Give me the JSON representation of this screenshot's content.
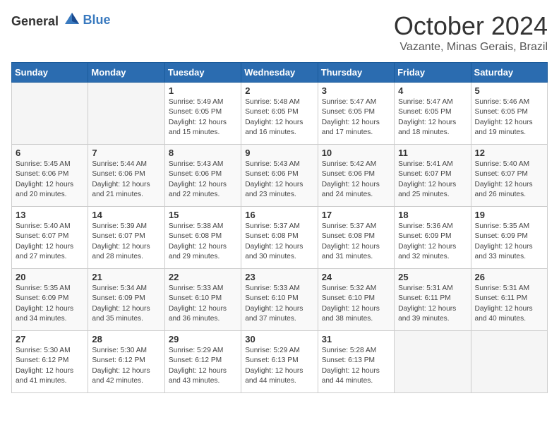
{
  "header": {
    "logo_general": "General",
    "logo_blue": "Blue",
    "month_year": "October 2024",
    "location": "Vazante, Minas Gerais, Brazil"
  },
  "days_of_week": [
    "Sunday",
    "Monday",
    "Tuesday",
    "Wednesday",
    "Thursday",
    "Friday",
    "Saturday"
  ],
  "weeks": [
    [
      {
        "day": "",
        "empty": true
      },
      {
        "day": "",
        "empty": true
      },
      {
        "day": "1",
        "sunrise": "5:49 AM",
        "sunset": "6:05 PM",
        "daylight": "12 hours and 15 minutes."
      },
      {
        "day": "2",
        "sunrise": "5:48 AM",
        "sunset": "6:05 PM",
        "daylight": "12 hours and 16 minutes."
      },
      {
        "day": "3",
        "sunrise": "5:47 AM",
        "sunset": "6:05 PM",
        "daylight": "12 hours and 17 minutes."
      },
      {
        "day": "4",
        "sunrise": "5:47 AM",
        "sunset": "6:05 PM",
        "daylight": "12 hours and 18 minutes."
      },
      {
        "day": "5",
        "sunrise": "5:46 AM",
        "sunset": "6:05 PM",
        "daylight": "12 hours and 19 minutes."
      }
    ],
    [
      {
        "day": "6",
        "sunrise": "5:45 AM",
        "sunset": "6:06 PM",
        "daylight": "12 hours and 20 minutes."
      },
      {
        "day": "7",
        "sunrise": "5:44 AM",
        "sunset": "6:06 PM",
        "daylight": "12 hours and 21 minutes."
      },
      {
        "day": "8",
        "sunrise": "5:43 AM",
        "sunset": "6:06 PM",
        "daylight": "12 hours and 22 minutes."
      },
      {
        "day": "9",
        "sunrise": "5:43 AM",
        "sunset": "6:06 PM",
        "daylight": "12 hours and 23 minutes."
      },
      {
        "day": "10",
        "sunrise": "5:42 AM",
        "sunset": "6:06 PM",
        "daylight": "12 hours and 24 minutes."
      },
      {
        "day": "11",
        "sunrise": "5:41 AM",
        "sunset": "6:07 PM",
        "daylight": "12 hours and 25 minutes."
      },
      {
        "day": "12",
        "sunrise": "5:40 AM",
        "sunset": "6:07 PM",
        "daylight": "12 hours and 26 minutes."
      }
    ],
    [
      {
        "day": "13",
        "sunrise": "5:40 AM",
        "sunset": "6:07 PM",
        "daylight": "12 hours and 27 minutes."
      },
      {
        "day": "14",
        "sunrise": "5:39 AM",
        "sunset": "6:07 PM",
        "daylight": "12 hours and 28 minutes."
      },
      {
        "day": "15",
        "sunrise": "5:38 AM",
        "sunset": "6:08 PM",
        "daylight": "12 hours and 29 minutes."
      },
      {
        "day": "16",
        "sunrise": "5:37 AM",
        "sunset": "6:08 PM",
        "daylight": "12 hours and 30 minutes."
      },
      {
        "day": "17",
        "sunrise": "5:37 AM",
        "sunset": "6:08 PM",
        "daylight": "12 hours and 31 minutes."
      },
      {
        "day": "18",
        "sunrise": "5:36 AM",
        "sunset": "6:09 PM",
        "daylight": "12 hours and 32 minutes."
      },
      {
        "day": "19",
        "sunrise": "5:35 AM",
        "sunset": "6:09 PM",
        "daylight": "12 hours and 33 minutes."
      }
    ],
    [
      {
        "day": "20",
        "sunrise": "5:35 AM",
        "sunset": "6:09 PM",
        "daylight": "12 hours and 34 minutes."
      },
      {
        "day": "21",
        "sunrise": "5:34 AM",
        "sunset": "6:09 PM",
        "daylight": "12 hours and 35 minutes."
      },
      {
        "day": "22",
        "sunrise": "5:33 AM",
        "sunset": "6:10 PM",
        "daylight": "12 hours and 36 minutes."
      },
      {
        "day": "23",
        "sunrise": "5:33 AM",
        "sunset": "6:10 PM",
        "daylight": "12 hours and 37 minutes."
      },
      {
        "day": "24",
        "sunrise": "5:32 AM",
        "sunset": "6:10 PM",
        "daylight": "12 hours and 38 minutes."
      },
      {
        "day": "25",
        "sunrise": "5:31 AM",
        "sunset": "6:11 PM",
        "daylight": "12 hours and 39 minutes."
      },
      {
        "day": "26",
        "sunrise": "5:31 AM",
        "sunset": "6:11 PM",
        "daylight": "12 hours and 40 minutes."
      }
    ],
    [
      {
        "day": "27",
        "sunrise": "5:30 AM",
        "sunset": "6:12 PM",
        "daylight": "12 hours and 41 minutes."
      },
      {
        "day": "28",
        "sunrise": "5:30 AM",
        "sunset": "6:12 PM",
        "daylight": "12 hours and 42 minutes."
      },
      {
        "day": "29",
        "sunrise": "5:29 AM",
        "sunset": "6:12 PM",
        "daylight": "12 hours and 43 minutes."
      },
      {
        "day": "30",
        "sunrise": "5:29 AM",
        "sunset": "6:13 PM",
        "daylight": "12 hours and 44 minutes."
      },
      {
        "day": "31",
        "sunrise": "5:28 AM",
        "sunset": "6:13 PM",
        "daylight": "12 hours and 44 minutes."
      },
      {
        "day": "",
        "empty": true
      },
      {
        "day": "",
        "empty": true
      }
    ]
  ]
}
